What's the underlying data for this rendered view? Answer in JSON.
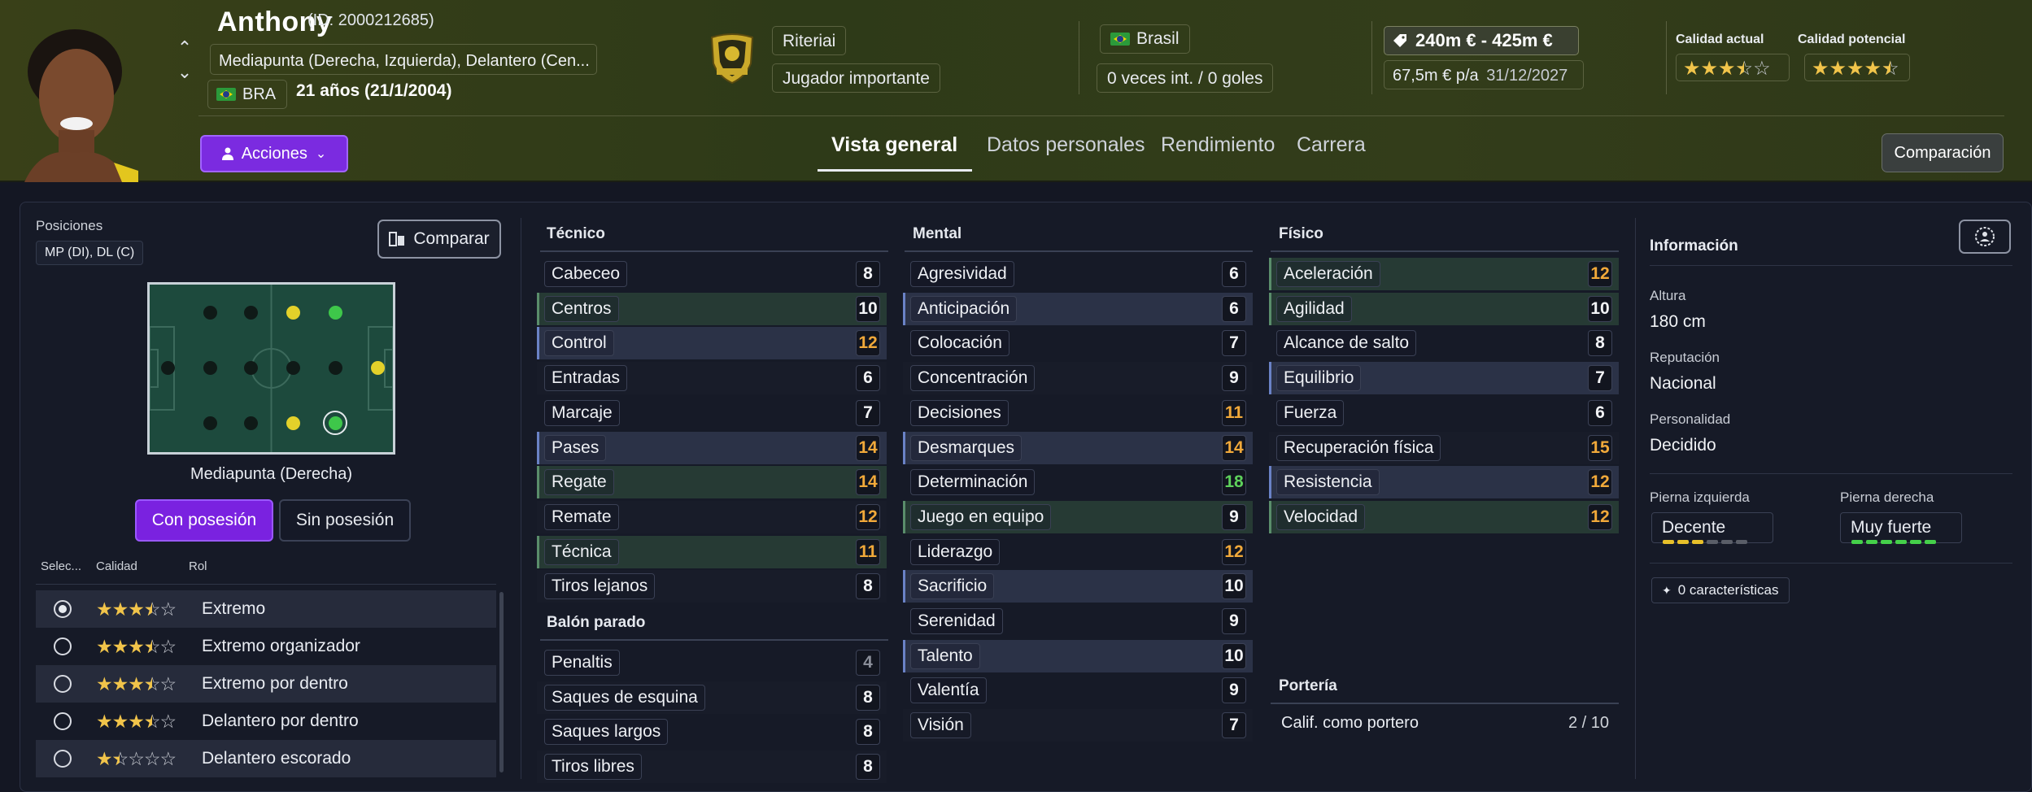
{
  "player": {
    "name": "Anthony",
    "id_label": "(ID: 2000212685)",
    "positions": "Mediapunta (Derecha, Izquierda), Delantero (Cen...",
    "nationality_code": "BRA",
    "age": "21 años (21/1/2004)"
  },
  "actions_label": "Acciones",
  "club": {
    "name": "Riteriai",
    "status": "Jugador importante"
  },
  "national": {
    "country": "Brasil",
    "caps": "0 veces int. / 0 goles"
  },
  "value": {
    "range": "240m € - 425m €",
    "wage": "67,5m € p/a",
    "contract_end": "31/12/2027"
  },
  "quality": {
    "current_label": "Calidad actual",
    "current_stars": 3.5,
    "potential_label": "Calidad potencial",
    "potential_stars": 4.5
  },
  "tabs": [
    "Vista general",
    "Datos personales",
    "Rendimiento",
    "Carrera"
  ],
  "compare_top_label": "Comparación",
  "positions_panel": {
    "title": "Posiciones",
    "badge": "MP (DI), DL (C)",
    "compare_label": "Comparar",
    "selected_position": "Mediapunta (Derecha)",
    "with_possession": "Con posesión",
    "without_possession": "Sin posesión",
    "col_select": "Selec...",
    "col_quality": "Calidad",
    "col_role": "Rol",
    "roles": [
      {
        "name": "Extremo",
        "stars": 3.5,
        "selected": true
      },
      {
        "name": "Extremo organizador",
        "stars": 3.5,
        "selected": false
      },
      {
        "name": "Extremo por dentro",
        "stars": 3.5,
        "selected": false
      },
      {
        "name": "Delantero por dentro",
        "stars": 3.5,
        "selected": false
      },
      {
        "name": "Delantero escorado",
        "stars": 1.5,
        "selected": false
      }
    ]
  },
  "tecnico": {
    "title": "Técnico",
    "attrs": [
      {
        "name": "Cabeceo",
        "value": "8"
      },
      {
        "name": "Centros",
        "value": "10"
      },
      {
        "name": "Control",
        "value": "12"
      },
      {
        "name": "Entradas",
        "value": "6"
      },
      {
        "name": "Marcaje",
        "value": "7"
      },
      {
        "name": "Pases",
        "value": "14"
      },
      {
        "name": "Regate",
        "value": "14"
      },
      {
        "name": "Remate",
        "value": "12"
      },
      {
        "name": "Técnica",
        "value": "11"
      },
      {
        "name": "Tiros lejanos",
        "value": "8"
      }
    ]
  },
  "balon_parado": {
    "title": "Balón parado",
    "attrs": [
      {
        "name": "Penaltis",
        "value": "4"
      },
      {
        "name": "Saques de esquina",
        "value": "8"
      },
      {
        "name": "Saques largos",
        "value": "8"
      },
      {
        "name": "Tiros libres",
        "value": "8"
      }
    ]
  },
  "mental": {
    "title": "Mental",
    "attrs": [
      {
        "name": "Agresividad",
        "value": "6"
      },
      {
        "name": "Anticipación",
        "value": "6"
      },
      {
        "name": "Colocación",
        "value": "7"
      },
      {
        "name": "Concentración",
        "value": "9"
      },
      {
        "name": "Decisiones",
        "value": "11"
      },
      {
        "name": "Desmarques",
        "value": "14"
      },
      {
        "name": "Determinación",
        "value": "18"
      },
      {
        "name": "Juego en equipo",
        "value": "9"
      },
      {
        "name": "Liderazgo",
        "value": "12"
      },
      {
        "name": "Sacrificio",
        "value": "10"
      },
      {
        "name": "Serenidad",
        "value": "9"
      },
      {
        "name": "Talento",
        "value": "10"
      },
      {
        "name": "Valentía",
        "value": "9"
      },
      {
        "name": "Visión",
        "value": "7"
      }
    ]
  },
  "fisico": {
    "title": "Físico",
    "attrs": [
      {
        "name": "Aceleración",
        "value": "12"
      },
      {
        "name": "Agilidad",
        "value": "10"
      },
      {
        "name": "Alcance de salto",
        "value": "8"
      },
      {
        "name": "Equilibrio",
        "value": "7"
      },
      {
        "name": "Fuerza",
        "value": "6"
      },
      {
        "name": "Recuperación física",
        "value": "15"
      },
      {
        "name": "Resistencia",
        "value": "12"
      },
      {
        "name": "Velocidad",
        "value": "12"
      }
    ]
  },
  "porteria": {
    "title": "Portería",
    "label": "Calif. como portero",
    "value": "2 / 10"
  },
  "info": {
    "title": "Información",
    "height_label": "Altura",
    "height": "180 cm",
    "reputation_label": "Reputación",
    "reputation": "Nacional",
    "personality_label": "Personalidad",
    "personality": "Decidido",
    "left_foot_label": "Pierna izquierda",
    "left_foot": "Decente",
    "left_foot_level": 3,
    "right_foot_label": "Pierna derecha",
    "right_foot": "Muy fuerte",
    "right_foot_level": 6,
    "traits": "0 características"
  },
  "colors": {
    "accent_purple": "#7b2be0",
    "orange_value": "#f1a93a",
    "green_value": "#5ed15b",
    "star": "#f1c44a"
  }
}
